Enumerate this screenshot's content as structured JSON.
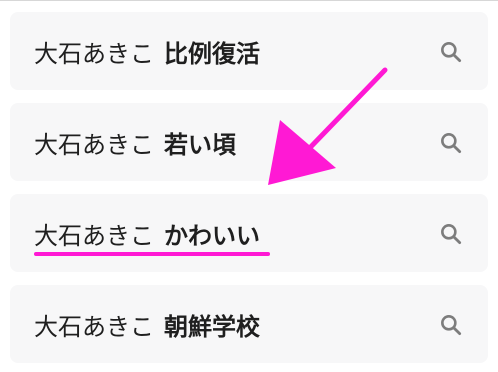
{
  "suggestions": [
    {
      "base": "大石あきこ",
      "suffix": "比例復活"
    },
    {
      "base": "大石あきこ",
      "suffix": "若い頃"
    },
    {
      "base": "大石あきこ",
      "suffix": "かわいい"
    },
    {
      "base": "大石あきこ",
      "suffix": "朝鮮学校"
    }
  ],
  "icons": {
    "search": "search-icon"
  },
  "colors": {
    "annotation": "#ff19d4",
    "item_background": "#f7f7f8",
    "text": "#1f1f1f",
    "icon": "#7d7d7d"
  },
  "annotation": {
    "highlighted_item": "suggestion 3",
    "type": "arrow-and-underline"
  }
}
